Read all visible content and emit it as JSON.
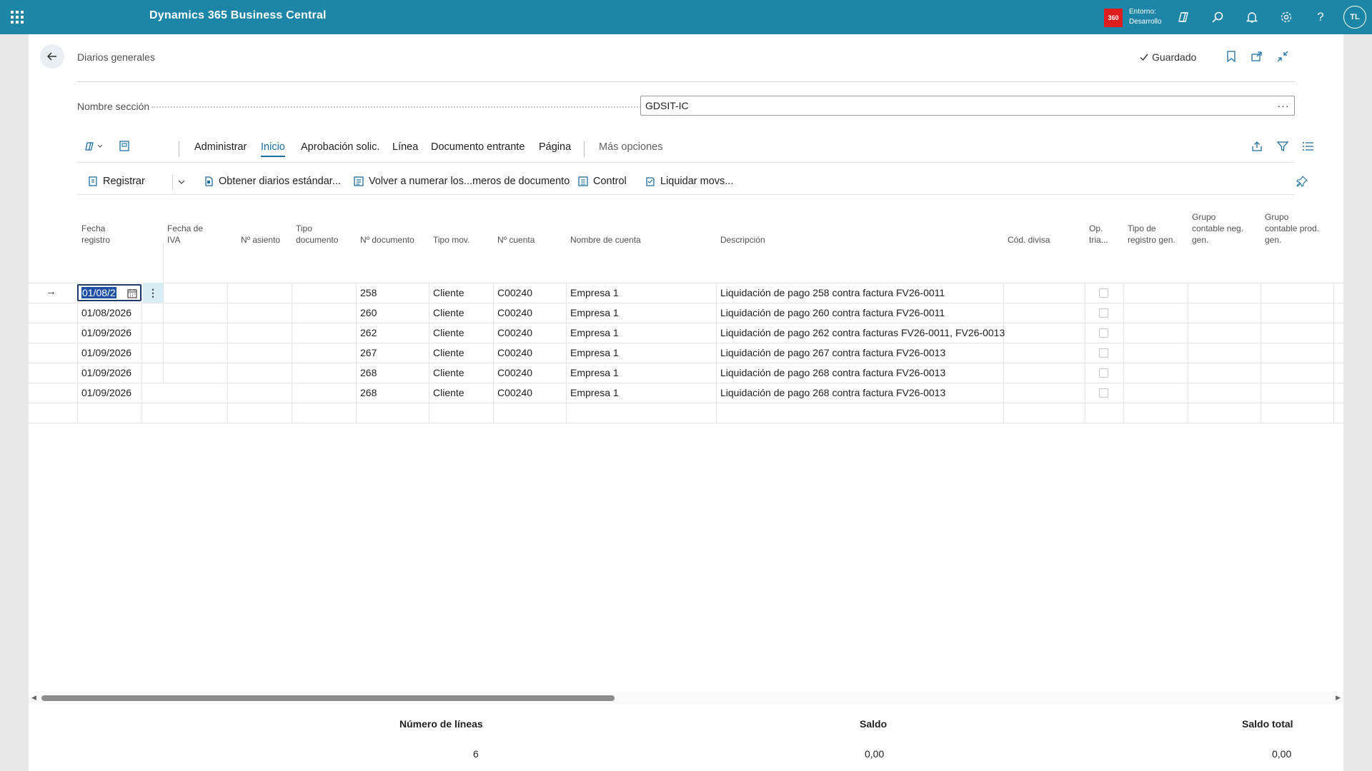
{
  "topbar": {
    "app_title": "Dynamics 365 Business Central",
    "env_badge": "360",
    "env_line1": "Entorno:",
    "env_line2": "Desarrollo",
    "avatar": "TL"
  },
  "header": {
    "title": "Diarios generales",
    "saved": "Guardado"
  },
  "section_field": {
    "label": "Nombre sección",
    "value": "GDSIT-IC",
    "more": "···"
  },
  "tabs": [
    "Administrar",
    "Inicio",
    "Aprobación solic.",
    "Línea",
    "Documento entrante",
    "Página",
    "Más opciones"
  ],
  "active_tab": "Inicio",
  "actions": {
    "registrar": "Registrar",
    "obtener": "Obtener diarios estándar...",
    "renumerar": "Volver a numerar los...meros de documento",
    "control": "Control",
    "liquidar": "Liquidar movs..."
  },
  "columns": {
    "fecha_registro": [
      "Fecha",
      "registro"
    ],
    "fecha_iva": [
      "Fecha de",
      "IVA"
    ],
    "asiento": "Nº asiento",
    "tipo_documento": [
      "Tipo",
      "documento"
    ],
    "num_documento": "Nº documento",
    "tipo_mov": "Tipo mov.",
    "num_cuenta": "Nº cuenta",
    "nombre_cuenta": "Nombre de cuenta",
    "descripcion": "Descripción",
    "cod_divisa": "Cód. divisa",
    "op_tria": [
      "Op.",
      "tria..."
    ],
    "tipo_registro_gen": [
      "Tipo de",
      "registro gen."
    ],
    "grupo_neg": [
      "Grupo",
      "contable neg.",
      "gen."
    ],
    "grupo_prod": [
      "Grupo",
      "contable prod.",
      "gen."
    ]
  },
  "rows": [
    {
      "fecha": "01/08/2",
      "num_doc": "258",
      "tipo_mov": "Cliente",
      "cuenta": "C00240",
      "nombre": "Empresa 1",
      "descripcion": "Liquidación de pago 258 contra factura FV26-0011"
    },
    {
      "fecha": "01/08/2026",
      "num_doc": "260",
      "tipo_mov": "Cliente",
      "cuenta": "C00240",
      "nombre": "Empresa 1",
      "descripcion": "Liquidación de pago 260 contra factura FV26-0011"
    },
    {
      "fecha": "01/09/2026",
      "num_doc": "262",
      "tipo_mov": "Cliente",
      "cuenta": "C00240",
      "nombre": "Empresa 1",
      "descripcion": "Liquidación de pago 262 contra facturas FV26-0011, FV26-0013"
    },
    {
      "fecha": "01/09/2026",
      "num_doc": "267",
      "tipo_mov": "Cliente",
      "cuenta": "C00240",
      "nombre": "Empresa 1",
      "descripcion": "Liquidación de pago 267 contra factura FV26-0013"
    },
    {
      "fecha": "01/09/2026",
      "num_doc": "268",
      "tipo_mov": "Cliente",
      "cuenta": "C00240",
      "nombre": "Empresa 1",
      "descripcion": "Liquidación de pago 268 contra factura FV26-0013"
    },
    {
      "fecha": "01/09/2026",
      "num_doc": "268",
      "tipo_mov": "Cliente",
      "cuenta": "C00240",
      "nombre": "Empresa 1",
      "descripcion": "Liquidación de pago 268 contra factura FV26-0013"
    }
  ],
  "footer": {
    "num_lineas_label": "Número de líneas",
    "num_lineas": "6",
    "saldo_label": "Saldo",
    "saldo": "0,00",
    "saldo_total_label": "Saldo total",
    "saldo_total": "0,00"
  },
  "colors": {
    "topbar": "#1d85a8",
    "accent": "#1d6fa0",
    "env_badge": "#e01d1d"
  }
}
